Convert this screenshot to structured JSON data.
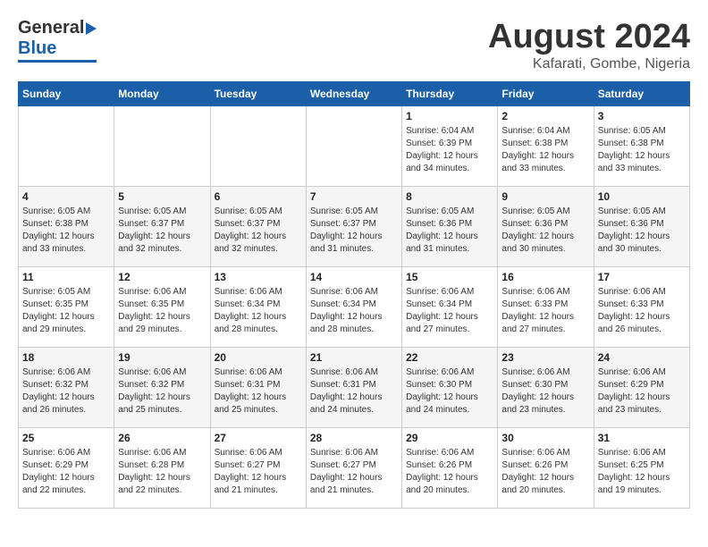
{
  "header": {
    "logo_general": "General",
    "logo_blue": "Blue",
    "title": "August 2024",
    "subtitle": "Kafarati, Gombe, Nigeria"
  },
  "weekdays": [
    "Sunday",
    "Monday",
    "Tuesday",
    "Wednesday",
    "Thursday",
    "Friday",
    "Saturday"
  ],
  "weeks": [
    [
      {
        "day": "",
        "info": ""
      },
      {
        "day": "",
        "info": ""
      },
      {
        "day": "",
        "info": ""
      },
      {
        "day": "",
        "info": ""
      },
      {
        "day": "1",
        "info": "Sunrise: 6:04 AM\nSunset: 6:39 PM\nDaylight: 12 hours\nand 34 minutes."
      },
      {
        "day": "2",
        "info": "Sunrise: 6:04 AM\nSunset: 6:38 PM\nDaylight: 12 hours\nand 33 minutes."
      },
      {
        "day": "3",
        "info": "Sunrise: 6:05 AM\nSunset: 6:38 PM\nDaylight: 12 hours\nand 33 minutes."
      }
    ],
    [
      {
        "day": "4",
        "info": "Sunrise: 6:05 AM\nSunset: 6:38 PM\nDaylight: 12 hours\nand 33 minutes."
      },
      {
        "day": "5",
        "info": "Sunrise: 6:05 AM\nSunset: 6:37 PM\nDaylight: 12 hours\nand 32 minutes."
      },
      {
        "day": "6",
        "info": "Sunrise: 6:05 AM\nSunset: 6:37 PM\nDaylight: 12 hours\nand 32 minutes."
      },
      {
        "day": "7",
        "info": "Sunrise: 6:05 AM\nSunset: 6:37 PM\nDaylight: 12 hours\nand 31 minutes."
      },
      {
        "day": "8",
        "info": "Sunrise: 6:05 AM\nSunset: 6:36 PM\nDaylight: 12 hours\nand 31 minutes."
      },
      {
        "day": "9",
        "info": "Sunrise: 6:05 AM\nSunset: 6:36 PM\nDaylight: 12 hours\nand 30 minutes."
      },
      {
        "day": "10",
        "info": "Sunrise: 6:05 AM\nSunset: 6:36 PM\nDaylight: 12 hours\nand 30 minutes."
      }
    ],
    [
      {
        "day": "11",
        "info": "Sunrise: 6:05 AM\nSunset: 6:35 PM\nDaylight: 12 hours\nand 29 minutes."
      },
      {
        "day": "12",
        "info": "Sunrise: 6:06 AM\nSunset: 6:35 PM\nDaylight: 12 hours\nand 29 minutes."
      },
      {
        "day": "13",
        "info": "Sunrise: 6:06 AM\nSunset: 6:34 PM\nDaylight: 12 hours\nand 28 minutes."
      },
      {
        "day": "14",
        "info": "Sunrise: 6:06 AM\nSunset: 6:34 PM\nDaylight: 12 hours\nand 28 minutes."
      },
      {
        "day": "15",
        "info": "Sunrise: 6:06 AM\nSunset: 6:34 PM\nDaylight: 12 hours\nand 27 minutes."
      },
      {
        "day": "16",
        "info": "Sunrise: 6:06 AM\nSunset: 6:33 PM\nDaylight: 12 hours\nand 27 minutes."
      },
      {
        "day": "17",
        "info": "Sunrise: 6:06 AM\nSunset: 6:33 PM\nDaylight: 12 hours\nand 26 minutes."
      }
    ],
    [
      {
        "day": "18",
        "info": "Sunrise: 6:06 AM\nSunset: 6:32 PM\nDaylight: 12 hours\nand 26 minutes."
      },
      {
        "day": "19",
        "info": "Sunrise: 6:06 AM\nSunset: 6:32 PM\nDaylight: 12 hours\nand 25 minutes."
      },
      {
        "day": "20",
        "info": "Sunrise: 6:06 AM\nSunset: 6:31 PM\nDaylight: 12 hours\nand 25 minutes."
      },
      {
        "day": "21",
        "info": "Sunrise: 6:06 AM\nSunset: 6:31 PM\nDaylight: 12 hours\nand 24 minutes."
      },
      {
        "day": "22",
        "info": "Sunrise: 6:06 AM\nSunset: 6:30 PM\nDaylight: 12 hours\nand 24 minutes."
      },
      {
        "day": "23",
        "info": "Sunrise: 6:06 AM\nSunset: 6:30 PM\nDaylight: 12 hours\nand 23 minutes."
      },
      {
        "day": "24",
        "info": "Sunrise: 6:06 AM\nSunset: 6:29 PM\nDaylight: 12 hours\nand 23 minutes."
      }
    ],
    [
      {
        "day": "25",
        "info": "Sunrise: 6:06 AM\nSunset: 6:29 PM\nDaylight: 12 hours\nand 22 minutes."
      },
      {
        "day": "26",
        "info": "Sunrise: 6:06 AM\nSunset: 6:28 PM\nDaylight: 12 hours\nand 22 minutes."
      },
      {
        "day": "27",
        "info": "Sunrise: 6:06 AM\nSunset: 6:27 PM\nDaylight: 12 hours\nand 21 minutes."
      },
      {
        "day": "28",
        "info": "Sunrise: 6:06 AM\nSunset: 6:27 PM\nDaylight: 12 hours\nand 21 minutes."
      },
      {
        "day": "29",
        "info": "Sunrise: 6:06 AM\nSunset: 6:26 PM\nDaylight: 12 hours\nand 20 minutes."
      },
      {
        "day": "30",
        "info": "Sunrise: 6:06 AM\nSunset: 6:26 PM\nDaylight: 12 hours\nand 20 minutes."
      },
      {
        "day": "31",
        "info": "Sunrise: 6:06 AM\nSunset: 6:25 PM\nDaylight: 12 hours\nand 19 minutes."
      }
    ]
  ]
}
